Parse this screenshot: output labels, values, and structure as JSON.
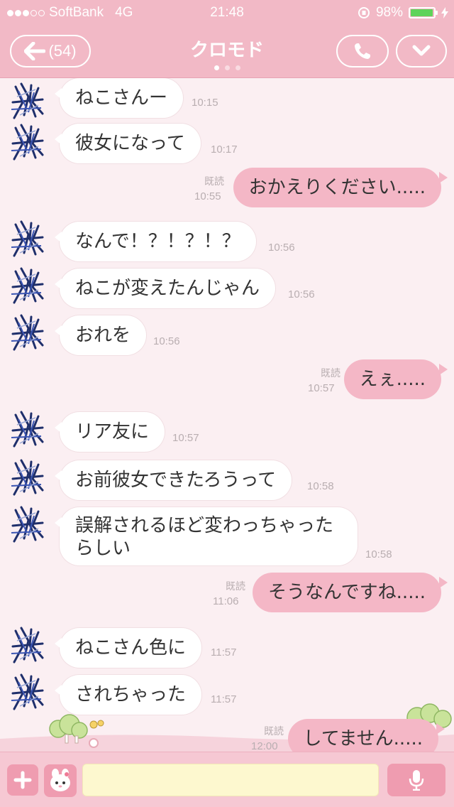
{
  "status_bar": {
    "carrier": "SoftBank",
    "network": "4G",
    "time": "21:48",
    "battery": "98%",
    "battery_level": 0.98,
    "signal_bars_filled": 3,
    "signal_bars_total": 5
  },
  "header": {
    "back_count": "(54)",
    "title": "クロモド",
    "page_count": 3,
    "active_page": 0
  },
  "colors": {
    "header_bg": "#f2b9c6",
    "chat_bg": "#fbeff2",
    "outgoing_bubble": "#f4b7c6",
    "incoming_bubble": "#ffffff",
    "input_bg": "#fdf8cf",
    "battery_fill": "#5fd35a"
  },
  "messages": [
    {
      "direction": "in",
      "text": "ねこさんー",
      "time": "10:15"
    },
    {
      "direction": "in",
      "text": "彼女になって",
      "time": "10:17"
    },
    {
      "direction": "out",
      "text": "おかえりください.....",
      "time": "10:55",
      "read": "既読"
    },
    {
      "direction": "in",
      "text": "なんで！？！？！？",
      "time": "10:56"
    },
    {
      "direction": "in",
      "text": "ねこが変えたんじゃん",
      "time": "10:56"
    },
    {
      "direction": "in",
      "text": "おれを",
      "time": "10:56"
    },
    {
      "direction": "out",
      "text": "えぇ.....",
      "time": "10:57",
      "read": "既読"
    },
    {
      "direction": "in",
      "text": "リア友に",
      "time": "10:57"
    },
    {
      "direction": "in",
      "text": "お前彼女できたろうって",
      "time": "10:58"
    },
    {
      "direction": "in",
      "text": "誤解されるほど変わっちゃったらしい",
      "time": "10:58"
    },
    {
      "direction": "out",
      "text": "そうなんですね.....",
      "time": "11:06",
      "read": "既読"
    },
    {
      "direction": "in",
      "text": "ねこさん色に",
      "time": "11:57"
    },
    {
      "direction": "in",
      "text": "されちゃった",
      "time": "11:57"
    },
    {
      "direction": "out",
      "text": "してません.....",
      "time": "12:00",
      "read": "既読"
    }
  ],
  "input": {
    "value": "",
    "placeholder": ""
  },
  "icons": {
    "back": "left-arrow-icon",
    "call": "phone-icon",
    "menu": "chevron-down-icon",
    "plus": "plus-icon",
    "sticker": "sticker-icon",
    "mic": "microphone-icon",
    "avatar": "avatar-icon"
  }
}
